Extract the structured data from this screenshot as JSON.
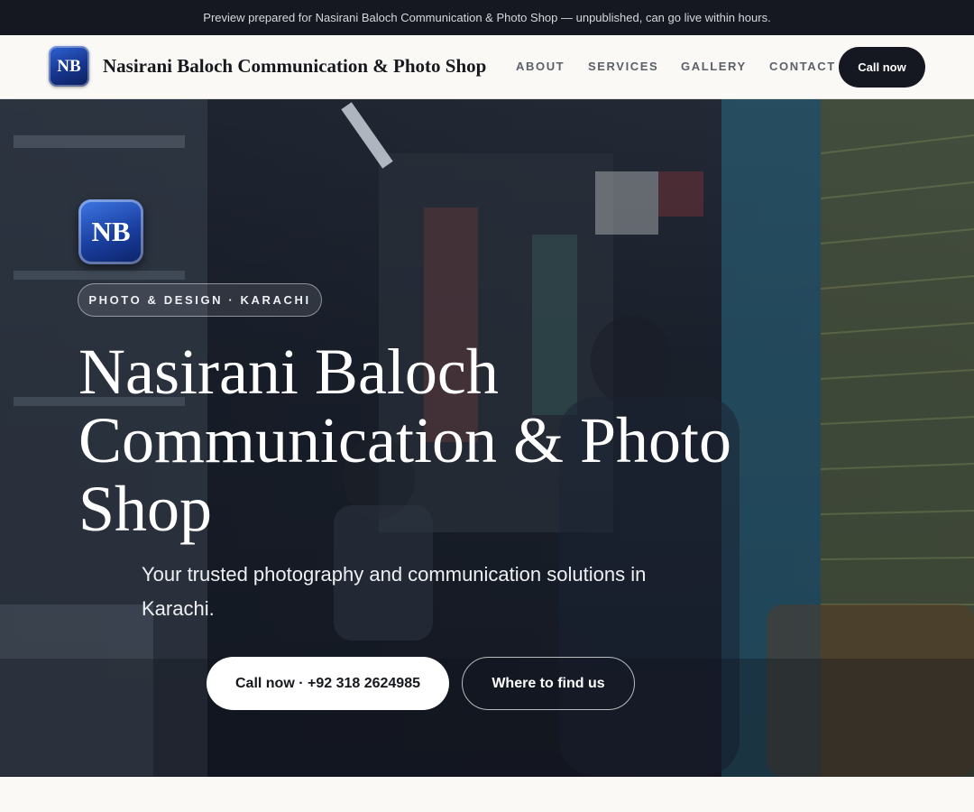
{
  "preview_banner": "Preview prepared for Nasirani Baloch Communication & Photo Shop — unpublished, can go live within hours.",
  "brand": {
    "initials": "NB",
    "name": "Nasirani Baloch Communication & Photo Shop"
  },
  "nav": {
    "items": [
      "ABOUT",
      "SERVICES",
      "GALLERY",
      "CONTACT"
    ],
    "call_label": "Call now"
  },
  "hero": {
    "badge_initials": "NB",
    "tag": "PHOTO & DESIGN · KARACHI",
    "title": "Nasirani Baloch Communication & Photo Shop",
    "subtitle": "Your trusted photography and communication solutions in Karachi.",
    "primary_cta": "Call now · +92 318 2624985",
    "secondary_cta": "Where to find us"
  },
  "colors": {
    "dark": "#151821",
    "accent_blue": "#1a3fa0",
    "page_bg": "#faf9f6"
  }
}
